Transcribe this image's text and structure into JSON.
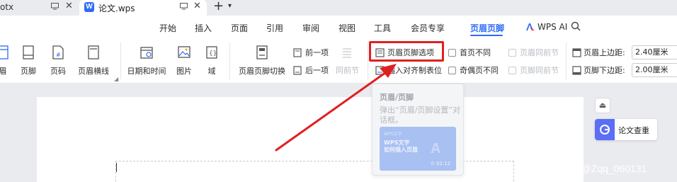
{
  "titlebar": {
    "prev_tab_label": "otx",
    "active_tab_label": "论文.wps",
    "wps_logo": "W"
  },
  "menu": {
    "items": [
      "开始",
      "插入",
      "页面",
      "引用",
      "审阅",
      "视图",
      "工具",
      "会员专享",
      "页眉页脚",
      "WPS AI"
    ],
    "active": "页眉页脚"
  },
  "ribbon": {
    "header_label": "眉",
    "footer_label": "页脚",
    "page_number_label": "页码",
    "header_line_label": "页眉横线",
    "datetime_label": "日期和时间",
    "picture_label": "图片",
    "field_label": "域",
    "switch_label": "页眉页脚切换",
    "prev_label": "前一项",
    "next_label": "后一项",
    "same_as_prev_label": "同前节",
    "options_label": "页眉页脚选项",
    "insert_align_tab_label": "插入对齐制表位",
    "first_page_diff_label": "首页不同",
    "odd_even_diff_label": "奇偶页不同",
    "header_same_prev_label": "页眉同前节",
    "footer_same_prev_label": "页脚同前节",
    "header_top_margin_label": "页眉上边距:",
    "header_top_margin_value": "2.40厘米",
    "footer_bottom_margin_label": "页脚下边距:",
    "footer_bottom_margin_value": "2.00厘米"
  },
  "tooltip": {
    "title": "页眉/页脚",
    "description": "弹出“页眉/页脚设置”对话框。",
    "video_small": "WPS文字",
    "video_line1": "WPS文字",
    "video_line2": "如何插入页眉",
    "video_big": "A",
    "video_duration": "⊙ 02:12"
  },
  "side": {
    "paper_check_label": "论文查重"
  },
  "watermark": "CSDN @Zqq_060131",
  "colors": {
    "accent": "#2f6bf5",
    "highlight_red": "#e02020",
    "titlebar_bg": "#e9ebef",
    "tooltip_video_bg": "#a8c0f2"
  }
}
